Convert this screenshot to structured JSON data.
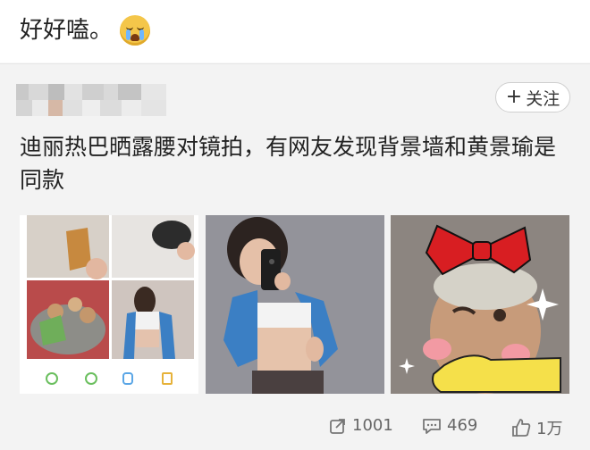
{
  "comment_text": "好好嗑。",
  "emoji": "crying-face-emoji",
  "post": {
    "follow_label": "关注",
    "text": "迪丽热巴晒露腰对镜拍，有网友发现背景墙和黄景瑜是同款"
  },
  "stats": {
    "reposts": "1001",
    "comments": "469",
    "likes": "1万"
  },
  "colors": {
    "accent": "#333333",
    "bow": "#d81e22",
    "sweater": "#3b7fc4"
  }
}
